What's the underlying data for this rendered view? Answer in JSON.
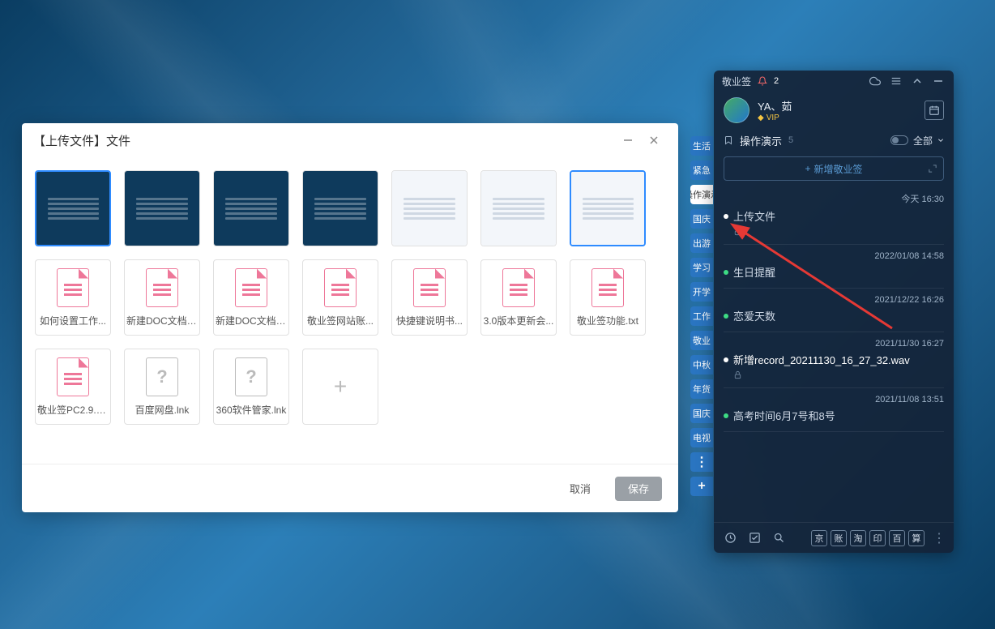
{
  "upload_dialog": {
    "title": "【上传文件】文件",
    "grid": {
      "thumbs": [
        {
          "selected": true,
          "variant": "dark"
        },
        {
          "selected": false,
          "variant": "dark"
        },
        {
          "selected": false,
          "variant": "dark"
        },
        {
          "selected": false,
          "variant": "dark"
        },
        {
          "selected": false,
          "variant": "light"
        },
        {
          "selected": false,
          "variant": "light"
        },
        {
          "selected": true,
          "variant": "light"
        }
      ],
      "docs": [
        {
          "label": "如何设置工作..."
        },
        {
          "label": "新建DOC文档(..."
        },
        {
          "label": "新建DOC文档(..."
        },
        {
          "label": "敬业签网站账..."
        },
        {
          "label": "快捷键说明书..."
        },
        {
          "label": "3.0版本更新会..."
        },
        {
          "label": "敬业签功能.txt"
        }
      ],
      "others": [
        {
          "kind": "doc",
          "label": "敬业签PC2.9.0..."
        },
        {
          "kind": "lnk",
          "label": "百度网盘.lnk"
        },
        {
          "kind": "lnk",
          "label": "360软件管家.lnk"
        }
      ]
    },
    "cancel_label": "取消",
    "save_label": "保存"
  },
  "side_tags": {
    "items": [
      "生活",
      "紧急",
      "国庆",
      "出游",
      "学习",
      "开学",
      "工作",
      "敬业",
      "中秋",
      "年货",
      "国庆",
      "电视"
    ],
    "active_label": "操作演示",
    "more_label": "⋮",
    "add_label": "+"
  },
  "notes_panel": {
    "app_name": "敬业签",
    "bell_count": "2",
    "user": {
      "name": "YA、茹",
      "vip": "VIP"
    },
    "category": {
      "name": "操作演示",
      "count": "5",
      "filter": "全部"
    },
    "add_label": "新增敬业签",
    "items": [
      {
        "time": "今天 16:30",
        "title": "上传文件",
        "dot": "white",
        "lock": true
      },
      {
        "time": "2022/01/08 14:58",
        "title": "生日提醒",
        "dot": "green"
      },
      {
        "time": "2021/12/22 16:26",
        "title": "恋爱天数",
        "dot": "green"
      },
      {
        "time": "2021/11/30 16:27",
        "title": "新增record_20211130_16_27_32.wav",
        "dot": "white",
        "lock": true,
        "highlight": true
      },
      {
        "time": "2021/11/08 13:51",
        "title": "高考时间6月7号和8号",
        "dot": "green"
      }
    ],
    "footer_pills": [
      "京",
      "账",
      "淘",
      "印",
      "百",
      "算"
    ]
  }
}
